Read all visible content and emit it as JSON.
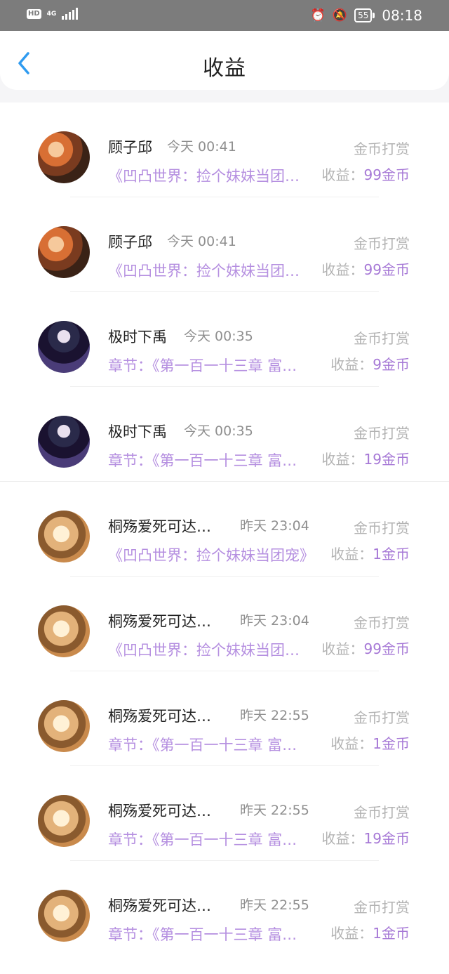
{
  "status_bar": {
    "hd": "HD",
    "network": "4G",
    "battery": "55",
    "time": "08:18"
  },
  "header": {
    "title": "收益",
    "back_icon": "chevron-left-icon",
    "accent_color": "#2f9bf0"
  },
  "colors": {
    "purple_text": "#b58fe0",
    "purple_value": "#a678d6",
    "gray_text": "#b3b3b3"
  },
  "rows": [
    {
      "name": "顾子邱",
      "time": "今天 00:41",
      "type": "金币打赏",
      "title": "《凹凸世界：捡个妹妹当团…",
      "income_label": "收益：",
      "income_value": "99金币"
    },
    {
      "name": "顾子邱",
      "time": "今天 00:41",
      "type": "金币打赏",
      "title": "《凹凸世界：捡个妹妹当团…",
      "income_label": "收益：",
      "income_value": "99金币"
    },
    {
      "name": "极时下禹",
      "time": "今天 00:35",
      "type": "金币打赏",
      "title": "章节：《第一百一十三章 富…",
      "income_label": "收益：",
      "income_value": "9金币"
    },
    {
      "name": "极时下禹",
      "time": "今天 00:35",
      "type": "金币打赏",
      "title": "章节：《第一百一十三章 富…",
      "income_label": "收益：",
      "income_value": "19金币"
    },
    {
      "name": "桐殇爱死可达…",
      "time": "昨天 23:04",
      "type": "金币打赏",
      "title": "《凹凸世界：捡个妹妹当团宠》",
      "income_label": "收益：",
      "income_value": "1金币"
    },
    {
      "name": "桐殇爱死可达…",
      "time": "昨天 23:04",
      "type": "金币打赏",
      "title": "《凹凸世界：捡个妹妹当团…",
      "income_label": "收益：",
      "income_value": "99金币"
    },
    {
      "name": "桐殇爱死可达…",
      "time": "昨天 22:55",
      "type": "金币打赏",
      "title": "章节：《第一百一十三章 富…",
      "income_label": "收益：",
      "income_value": "1金币"
    },
    {
      "name": "桐殇爱死可达…",
      "time": "昨天 22:55",
      "type": "金币打赏",
      "title": "章节：《第一百一十三章 富…",
      "income_label": "收益：",
      "income_value": "19金币"
    },
    {
      "name": "桐殇爱死可达…",
      "time": "昨天 22:55",
      "type": "金币打赏",
      "title": "章节：《第一百一十三章 富…",
      "income_label": "收益：",
      "income_value": "1金币"
    }
  ]
}
